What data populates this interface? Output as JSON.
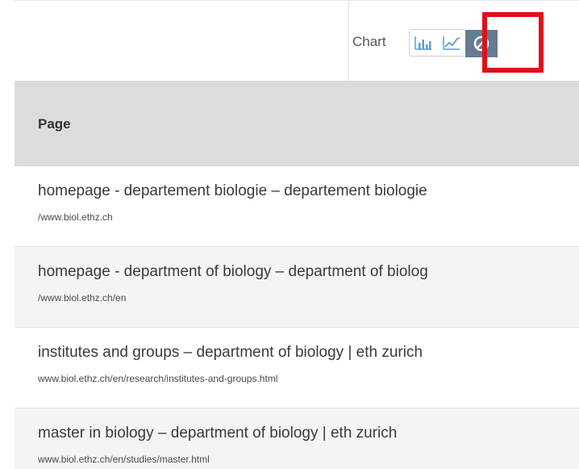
{
  "toolbar": {
    "chart_label": "Chart",
    "buttons": [
      {
        "name": "bar",
        "icon": "bar-chart-icon"
      },
      {
        "name": "line",
        "icon": "line-chart-icon"
      },
      {
        "name": "none",
        "icon": "no-chart-icon",
        "active": true
      }
    ],
    "active_color": "#647b90",
    "highlight_color": "#e0101a"
  },
  "table": {
    "header": "Page",
    "rows": [
      {
        "title": "homepage - departement biologie – departement biologie",
        "url": "/www.biol.ethz.ch"
      },
      {
        "title": "homepage - department of biology – department of biolog",
        "url": "/www.biol.ethz.ch/en"
      },
      {
        "title": "institutes and groups – department of biology | eth zurich",
        "url": "www.biol.ethz.ch/en/research/institutes-and-groups.html"
      },
      {
        "title": "master in biology – department of biology | eth zurich",
        "url": "www.biol.ethz.ch/en/studies/master.html"
      }
    ]
  }
}
